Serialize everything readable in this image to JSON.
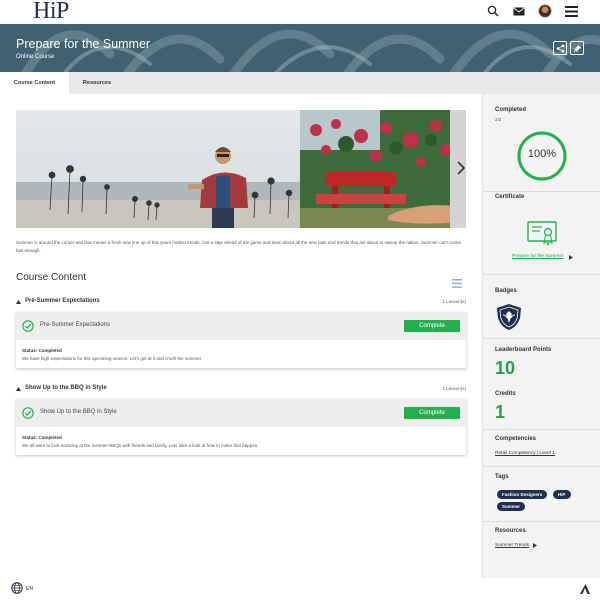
{
  "header": {
    "logo": "HiP",
    "icons": [
      "search-icon",
      "mail-icon",
      "user-avatar",
      "menu-icon"
    ]
  },
  "banner": {
    "title": "Prepare for the Summer",
    "subtitle": "Online Course",
    "buttons": [
      "share-icon",
      "pin-icon"
    ]
  },
  "tabs": [
    {
      "label": "Course Content",
      "active": true
    },
    {
      "label": "Resources",
      "active": false
    }
  ],
  "main": {
    "description": "Summer is around the corner and that means a fresh new line up of this years hottest trends. Get a step ahead of the game and learn about all the new fads and trends that are about to sweep the nation. Summer can't come fast enough.",
    "section_title": "Course Content",
    "groups": [
      {
        "name": "Pre-Summer Expectations",
        "count": "1 Lesson(s)",
        "lesson": "Pre-Summer Expectations",
        "button": "Complete",
        "status": "Status: Completed",
        "description": "We have high expectations for this upcoming season. Let's get at it and crush the summer."
      },
      {
        "name": "Show Up to the BBQ in Style",
        "count": "1 Lesson(s)",
        "lesson": "Show Up to the BBQ in Style",
        "button": "Complete",
        "status": "Status: Completed",
        "description": "We all want to look amazing at the summer BBQs with friends and family. Lets take a look at how to make that happen."
      }
    ]
  },
  "sidebar": {
    "completed_label": "Completed",
    "completed_count": "2/2",
    "progress_text": "100%",
    "progress_value": 1.0,
    "certificate_label": "Certificate",
    "certificate_link": "Prepare for the Summer",
    "badges_label": "Badges",
    "leaderboard_label": "Leaderboard Points",
    "leaderboard_value": "10",
    "credits_label": "Credits",
    "credits_value": "1",
    "competencies_label": "Competencies",
    "competency_link": "Retail Competency | Level 1",
    "tags_label": "Tags",
    "tags": [
      "Fashion Designers",
      "HiP",
      "Summer"
    ],
    "resources_label": "Resources",
    "resource_link": "Summer Trends"
  },
  "footer": {
    "language": "EN"
  },
  "colors": {
    "accent": "#25b04f",
    "navy": "#1f2f4f",
    "banner": "#3d5f6e"
  }
}
